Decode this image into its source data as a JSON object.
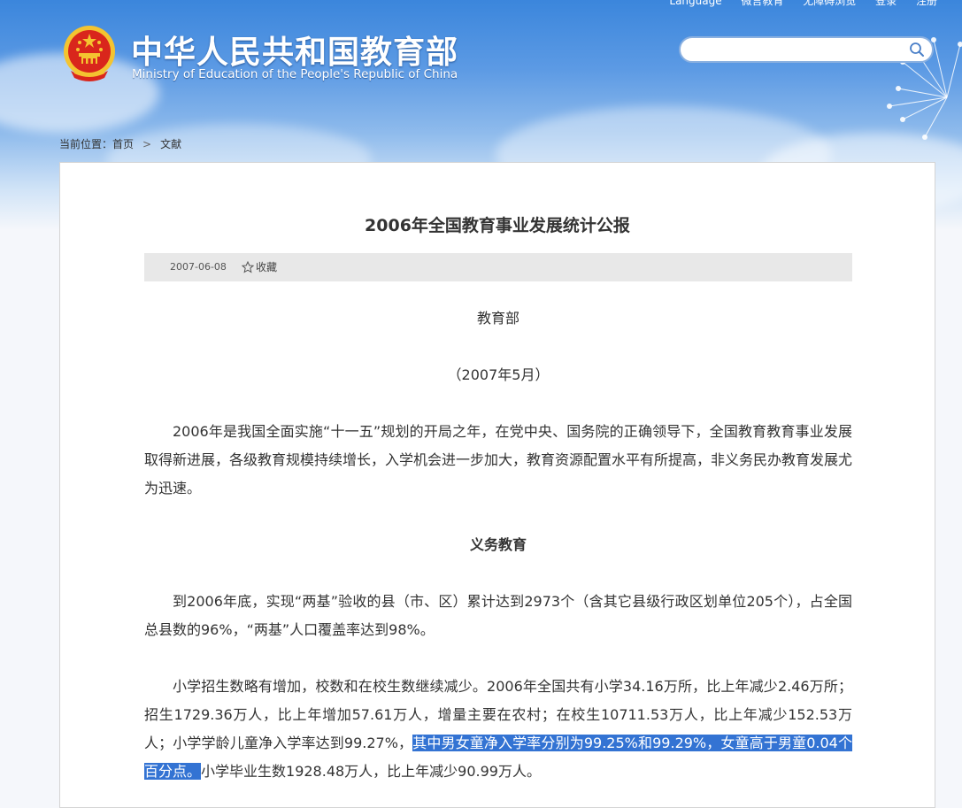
{
  "header": {
    "top_links": [
      "Language",
      "微言教育",
      "无障碍浏览",
      "登录",
      "注册"
    ],
    "title_cn": "中华人民共和国教育部",
    "title_en": "Ministry of Education of the People's Republic of China",
    "search": {
      "placeholder": "",
      "value": ""
    }
  },
  "breadcrumb": {
    "prefix": "当前位置：",
    "home": "首页",
    "separator": ">",
    "current": "文献"
  },
  "article": {
    "title": "2006年全国教育事业发展统计公报",
    "date": "2007-06-08",
    "favorite_label": "收藏",
    "author": "教育部",
    "pub_date": "（2007年5月）",
    "intro": "2006年是我国全面实施“十一五”规划的开局之年，在党中央、国务院的正确领导下，全国教育教育事业发展取得新进展，各级教育规模持续增长，入学机会进一步加大，教育资源配置水平有所提高，非义务民办教育发展尤为迅速。",
    "section_title": "义务教育",
    "para1": "到2006年底，实现“两基”验收的县（市、区）累计达到2973个（含其它县级行政区划单位205个），占全国总县数的96%，“两基”人口覆盖率达到98%。",
    "para2_before": "小学招生数略有增加，校数和在校生数继续减少。2006年全国共有小学34.16万所，比上年减少2.46万所；招生1729.36万人，比上年增加57.61万人，增量主要在农村；在校生10711.53万人，比上年减少152.53万人；小学学龄儿童净入学率达到99.27%，",
    "para2_highlight": "其中男女童净入学率分别为99.25%和99.29%，女童高于男童0.04个百分点。",
    "para2_after": "小学毕业生数1928.48万人，比上年减少90.99万人。"
  },
  "colors": {
    "sky_top": "#3b86dc",
    "highlight": "#3373d3",
    "emblem_red": "#d9261c",
    "emblem_gold": "#f4c430"
  }
}
